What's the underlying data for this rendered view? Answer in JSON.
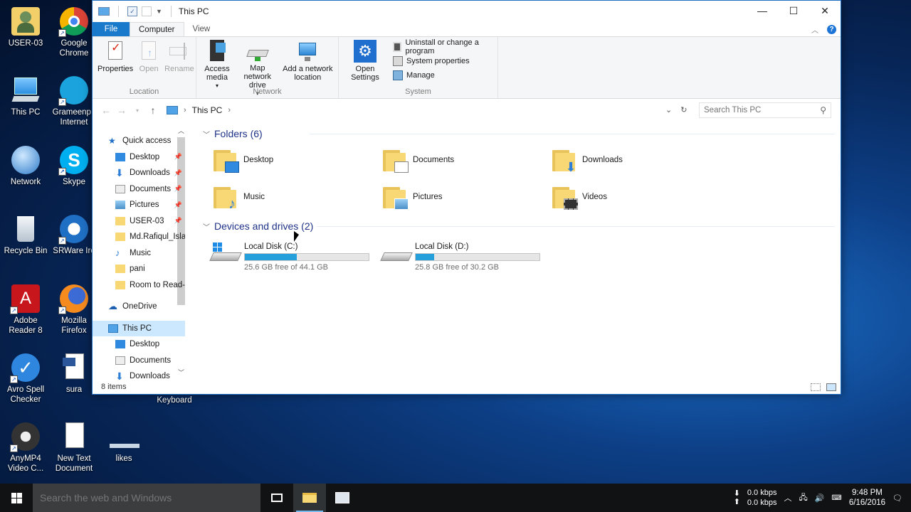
{
  "desktop": {
    "icons": [
      {
        "label": "USER-03",
        "icon": "user-folder-icon"
      },
      {
        "label": "Google Chrome",
        "icon": "chrome-icon"
      },
      {
        "label": "This PC",
        "icon": "computer-icon"
      },
      {
        "label": "Grameenp.. Internet",
        "icon": "grameenphone-icon"
      },
      {
        "label": "Network",
        "icon": "network-icon"
      },
      {
        "label": "Skype",
        "icon": "skype-icon"
      },
      {
        "label": "Recycle Bin",
        "icon": "recycle-bin-icon"
      },
      {
        "label": "SRWare Iro",
        "icon": "srware-iron-icon"
      },
      {
        "label": "Adobe Reader 8",
        "icon": "adobe-reader-icon"
      },
      {
        "label": "Mozilla Firefox",
        "icon": "firefox-icon"
      },
      {
        "label": "Avro Spell Checker",
        "icon": "avro-icon"
      },
      {
        "label": "sura",
        "icon": "document-icon"
      },
      {
        "label": "Keyboard",
        "icon": "keyboard-icon"
      },
      {
        "label": "AnyMP4 Video C...",
        "icon": "anymp4-icon"
      },
      {
        "label": "New Text Document",
        "icon": "text-document-icon"
      },
      {
        "label": "likes",
        "icon": "likes-icon"
      }
    ]
  },
  "window": {
    "title": "This PC",
    "controls": {
      "minimize": "—",
      "maximize": "☐",
      "close": "✕"
    }
  },
  "ribbon": {
    "tabs": [
      "File",
      "Computer",
      "View"
    ],
    "groups": {
      "location": {
        "name": "Location",
        "buttons": [
          "Properties",
          "Open",
          "Rename"
        ]
      },
      "network": {
        "name": "Network",
        "access_media": "Access media",
        "map_drive": "Map network drive",
        "add_location": "Add a network location"
      },
      "system": {
        "name": "System",
        "open_settings": "Open Settings",
        "uninstall": "Uninstall or change a program",
        "system_properties": "System properties",
        "manage": "Manage"
      }
    }
  },
  "address": {
    "path": "This PC",
    "search_placeholder": "Search This PC"
  },
  "navpane": {
    "quick_access": "Quick access",
    "quick_items": [
      "Desktop",
      "Downloads",
      "Documents",
      "Pictures",
      "USER-03",
      "Md.Rafiqul_Islan",
      "Music",
      "pani",
      "Room to Read-L"
    ],
    "onedrive": "OneDrive",
    "this_pc": "This PC",
    "pc_items": [
      "Desktop",
      "Documents",
      "Downloads"
    ]
  },
  "main": {
    "folders_header": "Folders (6)",
    "folders": [
      "Desktop",
      "Documents",
      "Downloads",
      "Music",
      "Pictures",
      "Videos"
    ],
    "drives_header": "Devices and drives (2)",
    "drives": [
      {
        "name": "Local Disk (C:)",
        "free": "25.6 GB free of 44.1 GB",
        "used_fraction": 0.42
      },
      {
        "name": "Local Disk (D:)",
        "free": "25.8 GB free of 30.2 GB",
        "used_fraction": 0.15
      }
    ]
  },
  "status": {
    "items": "8 items"
  },
  "taskbar": {
    "search_placeholder": "Search the web and Windows",
    "net_down": "0.0 kbps",
    "net_up": "0.0 kbps",
    "time": "9:48 PM",
    "date": "6/16/2016"
  },
  "colors": {
    "accent": "#1979ca",
    "drive_fill": "#26a0da",
    "folder": "#f8d775"
  }
}
